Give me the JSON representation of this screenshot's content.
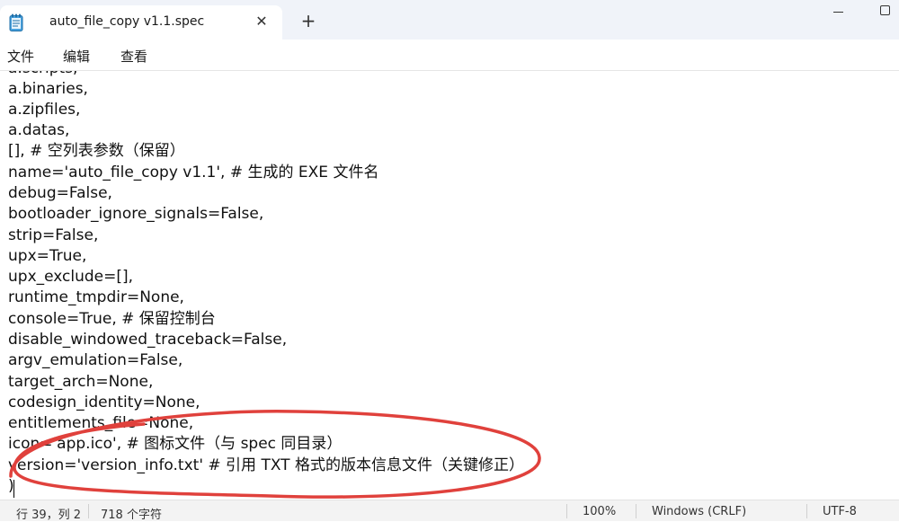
{
  "window": {
    "tab_title": "auto_file_copy v1.1.spec",
    "close_tab_glyph": "✕",
    "new_tab_glyph": "+"
  },
  "menu": {
    "file": "文件",
    "edit": "编辑",
    "view": "查看"
  },
  "editor": {
    "lines": [
      "a.scripts,",
      "a.binaries,",
      "a.zipfiles,",
      "a.datas,",
      "[], # 空列表参数（保留）",
      "name='auto_file_copy v1.1', # 生成的 EXE 文件名",
      "debug=False,",
      "bootloader_ignore_signals=False,",
      "strip=False,",
      "upx=True,",
      "upx_exclude=[],",
      "runtime_tmpdir=None,",
      "console=True, # 保留控制台",
      "disable_windowed_traceback=False,",
      "argv_emulation=False,",
      "target_arch=None,",
      "codesign_identity=None,",
      "entitlements_file=None,",
      "icon='app.ico', # 图标文件（与 spec 同目录）",
      "version='version_info.txt' # 引用 TXT 格式的版本信息文件（关键修正）",
      ")"
    ],
    "annotation_color": "#e0413c"
  },
  "status": {
    "position": "行 39，列 2",
    "char_count": "718 个字符",
    "zoom": "100%",
    "line_ending": "Windows (CRLF)",
    "encoding": "UTF-8"
  },
  "icons": {
    "app": "notepad-icon",
    "close": "close-icon",
    "add": "plus-icon",
    "minimize": "minimize-icon",
    "maximize": "maximize-icon"
  }
}
